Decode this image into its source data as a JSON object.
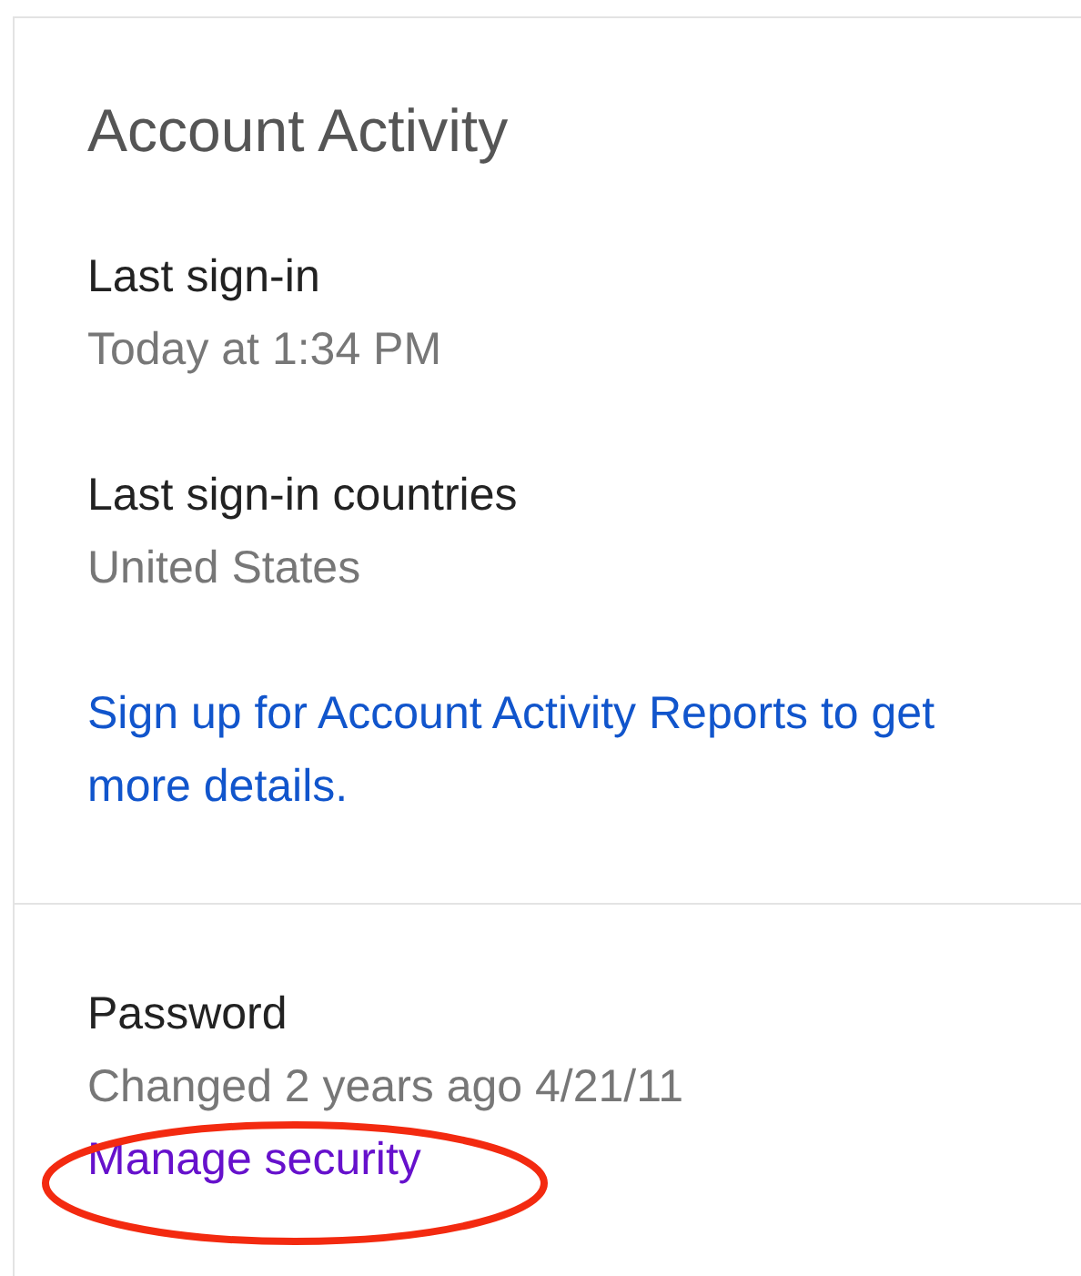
{
  "card": {
    "title": "Account Activity",
    "items": [
      {
        "label": "Last sign-in",
        "value": "Today at 1:34 PM"
      },
      {
        "label": "Last sign-in countries",
        "value": "United States"
      }
    ],
    "link": {
      "text": "Sign up for Account Activity Reports to get more details.",
      "visited": false
    }
  },
  "password": {
    "label": "Password",
    "value": "Changed 2 years ago 4/21/11",
    "link": {
      "text": "Manage security",
      "visited": true,
      "circled": true
    }
  }
}
